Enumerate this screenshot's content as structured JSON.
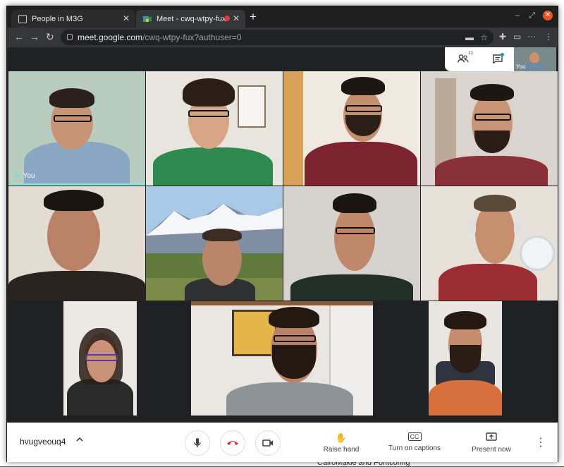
{
  "browser": {
    "tabs": [
      {
        "title": "People in M3G"
      },
      {
        "title": "Meet - cwq-wtpy-fux"
      }
    ],
    "new_tab": "+",
    "url_host": "meet.google.com",
    "url_path": "/cwq-wtpy-fux?authuser=0"
  },
  "meet": {
    "participants_count": "11",
    "self_label": "You",
    "tile_you_label": "You",
    "meeting_code": "hvugveouq4",
    "actions": {
      "raise_hand": "Raise hand",
      "captions": "Turn on captions",
      "present": "Present now"
    }
  },
  "colors": {
    "accent_speaking": "#8ae2d8",
    "hangup_red": "#d93025",
    "recording_dot": "#e53935"
  },
  "background_peek": {
    "bottom_text": "CairoMakie and Fontconfig"
  }
}
